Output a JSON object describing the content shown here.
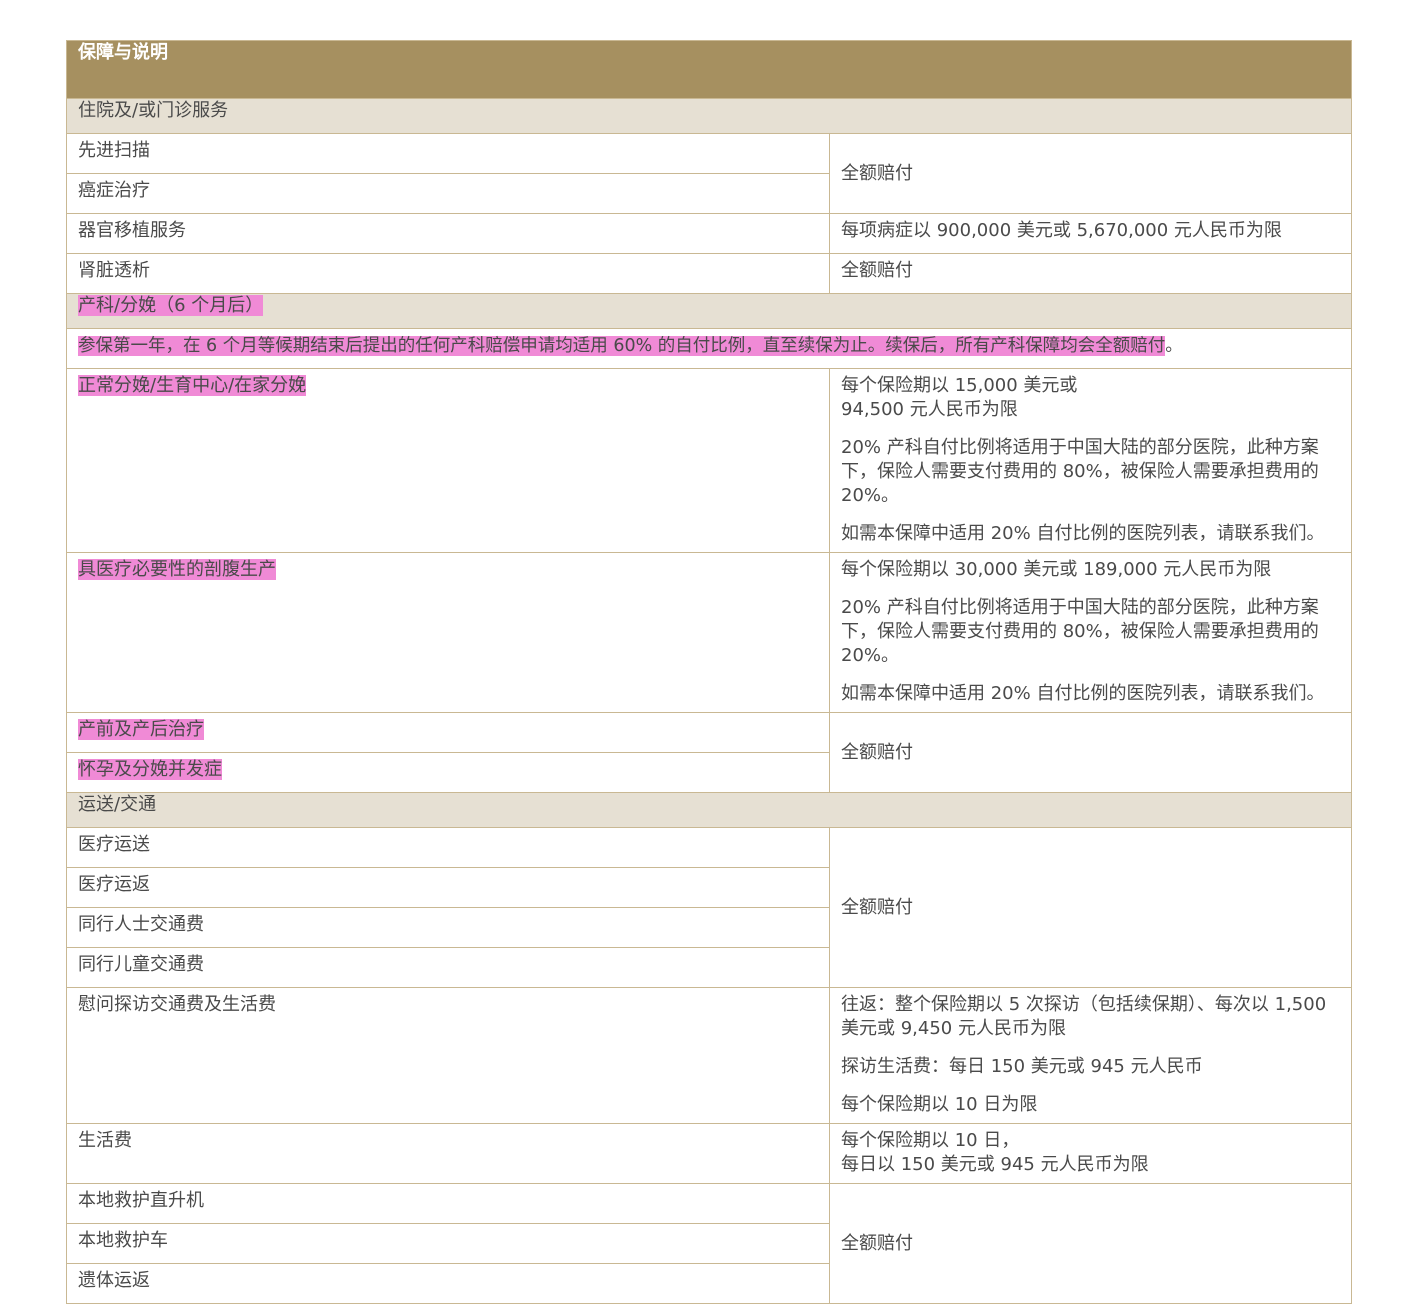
{
  "header": {
    "title": "保障与说明"
  },
  "section_inpatient": {
    "title": "住院及/或门诊服务",
    "rows": {
      "advanced_scan": "先进扫描",
      "cancer_treatment": "癌症治疗",
      "scan_cancer_value": "全额赔付",
      "organ_transplant": "器官移植服务",
      "organ_transplant_value": "每项病症以 900,000 美元或 5,670,000 元人民币为限",
      "kidney_dialysis": "肾脏透析",
      "kidney_dialysis_value": "全额赔付"
    }
  },
  "section_maternity": {
    "title": "产科/分娩（6 个月后）",
    "note": "参保第一年，在 6 个月等候期结束后提出的任何产科赔偿申请均适用 60% 的自付比例，直至续保为止。续保后，所有产科保障均会全额赔付",
    "note_end": "。",
    "normal_delivery": "正常分娩/生育中心/在家分娩",
    "normal_delivery_v1": "每个保险期以 15,000 美元或\n94,500 元人民币为限",
    "normal_delivery_v2": "20% 产科自付比例将适用于中国大陆的部分医院，此种方案下，保险人需要支付费用的 80%，被保险人需要承担费用的 20%。",
    "normal_delivery_v3": "如需本保障中适用 20% 自付比例的医院列表，请联系我们。",
    "c_section": "具医疗必要性的剖腹生产",
    "c_section_v1": "每个保险期以 30,000 美元或 189,000 元人民币为限",
    "c_section_v2": "20% 产科自付比例将适用于中国大陆的部分医院，此种方案下，保险人需要支付费用的 80%，被保险人需要承担费用的 20%。",
    "c_section_v3": "如需本保障中适用 20% 自付比例的医院列表，请联系我们。",
    "prenatal": "产前及产后治疗",
    "complications": "怀孕及分娩并发症",
    "prenatal_value": "全额赔付"
  },
  "section_transport": {
    "title": "运送/交通",
    "evacuation": "医疗运送",
    "repatriation": "医疗运返",
    "companion": "同行人士交通费",
    "child_companion": "同行儿童交通费",
    "group_value": "全额赔付",
    "compassionate": "慰问探访交通费及生活费",
    "compassionate_v1": "往返：整个保险期以 5 次探访（包括续保期）、每次以 1,500 美元或 9,450 元人民币为限",
    "compassionate_v2": "探访生活费：每日 150 美元或 945 元人民币",
    "compassionate_v3": "每个保险期以 10 日为限",
    "living": "生活费",
    "living_value": "每个保险期以 10 日，\n每日以 150 美元或 945 元人民币为限",
    "helicopter": "本地救护直升机",
    "ambulance": "本地救护车",
    "mortal_remains": "遗体运返",
    "local_value": "全额赔付"
  }
}
